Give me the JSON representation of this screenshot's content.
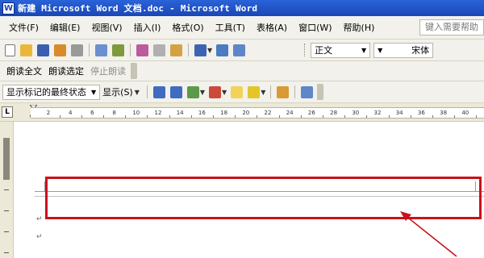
{
  "window": {
    "title": "新建 Microsoft Word 文档.doc - Microsoft Word"
  },
  "menubar": {
    "items": [
      "文件(F)",
      "编辑(E)",
      "视图(V)",
      "插入(I)",
      "格式(O)",
      "工具(T)",
      "表格(A)",
      "窗口(W)",
      "帮助(H)"
    ],
    "help_placeholder": "键入需要帮助"
  },
  "standard_toolbar": {
    "icons": [
      "new-document-icon",
      "open-icon",
      "save-icon",
      "permission-icon",
      "print-icon",
      "print-preview-icon",
      "spelling-icon",
      "research-icon",
      "copy-icon",
      "paste-icon",
      "undo-icon",
      "hyperlink-icon",
      "table-icon"
    ],
    "style": "正文",
    "font": "宋体"
  },
  "reading_toolbar": {
    "read_all": "朗读全文",
    "read_selection": "朗读选定",
    "stop_reading": "停止朗读"
  },
  "reviewing_toolbar": {
    "markup_view": "显示标记的最终状态",
    "show": "显示(S)"
  },
  "ruler": {
    "numbers": [
      "2",
      "4",
      "6",
      "8",
      "10",
      "12",
      "14",
      "16",
      "18",
      "20",
      "22",
      "24",
      "26",
      "28",
      "30",
      "32",
      "34",
      "36",
      "38",
      "40"
    ]
  },
  "document": {
    "paragraph_mark": "↵"
  },
  "annotation": {
    "color": "#c8121b"
  }
}
